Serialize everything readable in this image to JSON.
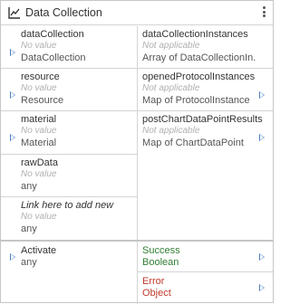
{
  "node": {
    "title": "Data Collection",
    "title_icon": "line-chart-icon",
    "menu_icon": "vertical-ellipsis-icon"
  },
  "colors": {
    "border": "#c6c6c6",
    "divider": "#d4d4d4",
    "port_arrow": "#4a7fc1",
    "placeholder": "#b0b0b0",
    "success": "#2e7d32",
    "error": "#c0392b"
  },
  "inputs": [
    {
      "name": "dataCollection",
      "value": "No value",
      "type": "DataCollection"
    },
    {
      "name": "resource",
      "value": "No value",
      "type": "Resource"
    },
    {
      "name": "material",
      "value": "No value",
      "type": "Material"
    },
    {
      "name": "rawData",
      "value": "No value",
      "type": "any"
    },
    {
      "name": "Link here to add new",
      "value": "No value",
      "type": "any"
    }
  ],
  "outputs": [
    {
      "name": "dataCollectionInstances",
      "value": "Not applicable",
      "type": "Array of DataCollectionIn..."
    },
    {
      "name": "openedProtocolInstances",
      "value": "Not applicable",
      "type": "Map of ProtocolInstance"
    },
    {
      "name": "postChartDataPointResults",
      "value": "Not applicable",
      "type": "Map of ChartDataPoint"
    }
  ],
  "exec": {
    "input": {
      "name": "Activate",
      "type": "any"
    },
    "success": {
      "name": "Success",
      "type": "Boolean"
    },
    "error": {
      "name": "Error",
      "type": "Object"
    }
  }
}
